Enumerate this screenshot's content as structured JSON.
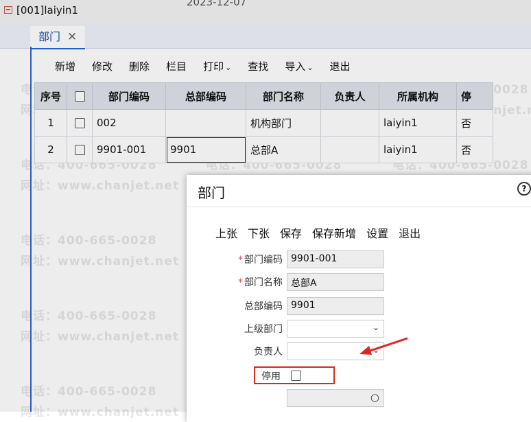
{
  "app": {
    "title": "[001]laiyin1",
    "date": "2023-12-07"
  },
  "tab": {
    "label": "部门",
    "close_glyph": "✕"
  },
  "toolbar": {
    "add": "新增",
    "edit": "修改",
    "delete": "删除",
    "columns": "栏目",
    "print": "打印",
    "find": "查找",
    "import": "导入",
    "exit": "退出",
    "caret": "⌄"
  },
  "table": {
    "headers": [
      "序号",
      "",
      "部门编码",
      "总部编码",
      "部门名称",
      "负责人",
      "所属机构",
      "停"
    ],
    "rows": [
      {
        "no": "1",
        "dept_code": "002",
        "hq_code": "",
        "dept_name": "机构部门",
        "manager": "",
        "org": "laiyin1",
        "stopped": "否"
      },
      {
        "no": "2",
        "dept_code": "9901-001",
        "hq_code": "9901",
        "dept_name": "总部A",
        "manager": "",
        "org": "laiyin1",
        "stopped": "否"
      }
    ]
  },
  "dialog": {
    "title": "部门",
    "help_glyph": "?",
    "toolbar": {
      "prev": "上张",
      "next": "下张",
      "save": "保存",
      "save_new": "保存新增",
      "settings": "设置",
      "exit": "退出"
    },
    "fields": {
      "dept_code": {
        "label": "部门编码",
        "value": "9901-001",
        "required": true
      },
      "dept_name": {
        "label": "部门名称",
        "value": "总部A",
        "required": true
      },
      "hq_code": {
        "label": "总部编码",
        "value": "9901"
      },
      "parent_dept": {
        "label": "上级部门",
        "value": ""
      },
      "manager": {
        "label": "负责人",
        "value": ""
      },
      "stop": {
        "label": "停用",
        "checked": false
      }
    },
    "required_mark": "*",
    "chevron": "⌄",
    "search_glyph": "○"
  },
  "watermark": {
    "phone": "电话：400-665-0028",
    "site": "网址：www.chanjet.net"
  },
  "colors": {
    "accent": "#2f63c9",
    "highlight_box": "#e0241f"
  }
}
